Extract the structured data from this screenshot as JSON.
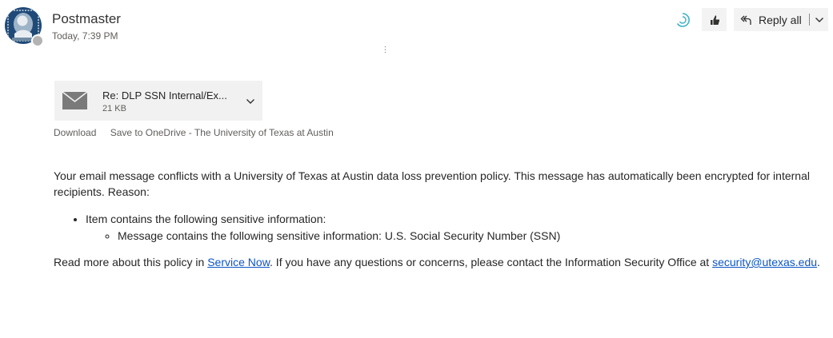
{
  "message": {
    "sender": "Postmaster",
    "time": "Today, 7:39 PM"
  },
  "toolbar": {
    "reply_all_label": "Reply all",
    "icons": [
      "loading-icon",
      "like-icon",
      "reply-all-icon",
      "chevron-down-icon"
    ]
  },
  "attachment": {
    "name": "Re: DLP SSN Internal/Ex...",
    "size": "21 KB",
    "download_label": "Download",
    "save_label": "Save to OneDrive - The University of Texas at Austin"
  },
  "body": {
    "intro": "Your email message conflicts with a University of Texas at Austin data loss prevention policy. This message has automatically been encrypted for internal recipients. Reason:",
    "bullet": "Item contains the following sensitive information:",
    "sub_bullet": "Message contains the following sensitive information: U.S. Social Security Number (SSN)",
    "footer_prefix": "Read more about this policy in ",
    "service_link": "Service Now",
    "footer_middle": ". If you have any questions or concerns, please contact the Information Security Office at ",
    "email_link": "security@utexas.edu",
    "footer_suffix": "."
  },
  "colors": {
    "link": "#0b55c4",
    "button_bg": "#f3f3f3",
    "attachment_bg": "#f1f1f1",
    "presence": "#b3b3b3"
  }
}
